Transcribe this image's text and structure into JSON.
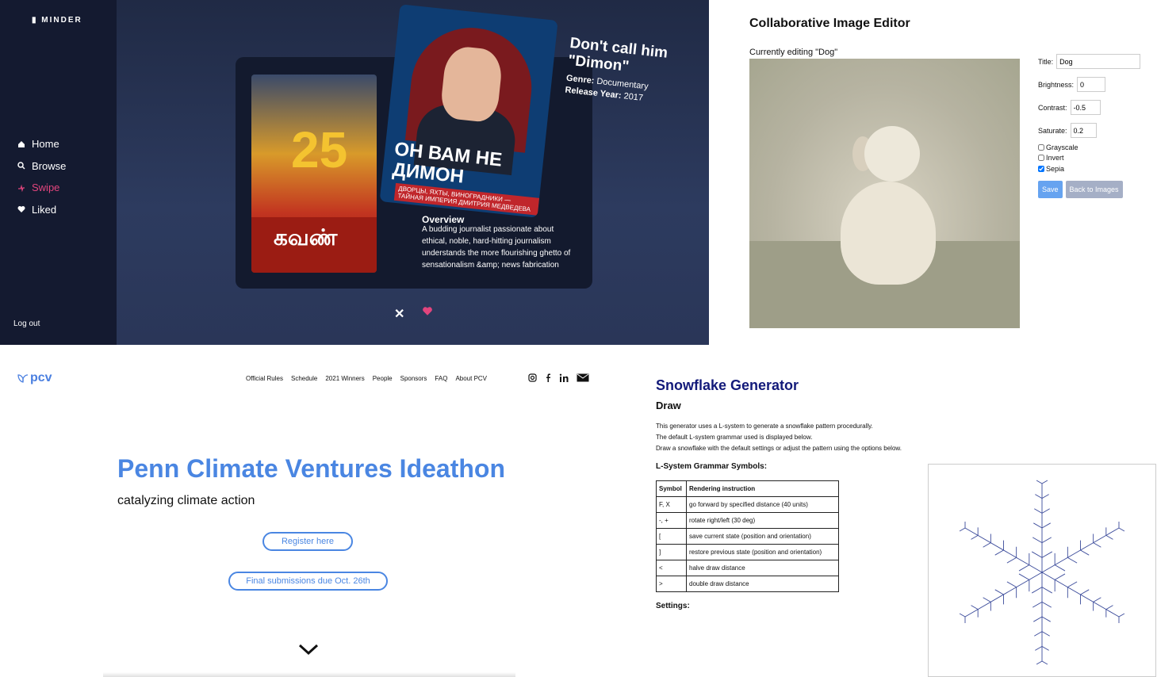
{
  "minder": {
    "brand": "MINDER",
    "nav": [
      {
        "label": "Home",
        "icon": "home-icon"
      },
      {
        "label": "Browse",
        "icon": "search-icon"
      },
      {
        "label": "Swipe",
        "icon": "swipe-icon",
        "active": true
      },
      {
        "label": "Liked",
        "icon": "heart-icon"
      }
    ],
    "logout": "Log out",
    "poster_back": {
      "number": "25",
      "title": "கவண்"
    },
    "poster_front": {
      "headline": "ОН ВАМ НЕ ДИМОН",
      "tagline": "ДВОРЦЫ, ЯХТЫ, ВИНОГРАДНИКИ — ТАЙНАЯ ИМПЕРИЯ ДМИТРИЯ МЕДВЕДЕВА"
    },
    "movie": {
      "title": "Don't call him \"Dimon\"",
      "genre_label": "Genre:",
      "genre": "Documentary",
      "year_label": "Release Year:",
      "year": "2017"
    },
    "overview_heading": "Overview",
    "overview_text": "A budding journalist passionate about ethical, noble, hard-hitting journalism understands the more flourishing ghetto of sensationalism &amp; news fabrication",
    "accent": "#e2457d"
  },
  "editor": {
    "title": "Collaborative Image Editor",
    "editing": "Currently editing \"Dog\"",
    "fields": {
      "title_label": "Title:",
      "title_value": "Dog",
      "brightness_label": "Brightness:",
      "brightness_value": "0",
      "contrast_label": "Contrast:",
      "contrast_value": "-0.5",
      "saturate_label": "Saturate:",
      "saturate_value": "0.2"
    },
    "checks": {
      "grayscale": "Grayscale",
      "invert": "Invert",
      "sepia": "Sepia"
    },
    "buttons": {
      "save": "Save",
      "back": "Back to Images"
    }
  },
  "pcv": {
    "logo": "pcv",
    "nav": [
      "Official Rules",
      "Schedule",
      "2021 Winners",
      "People",
      "Sponsors",
      "FAQ",
      "About PCV"
    ],
    "title": "Penn Climate Ventures Ideathon",
    "subtitle": "catalyzing climate action",
    "register": "Register here",
    "deadline": "Final submissions due Oct. 26th",
    "accent": "#4a86e2"
  },
  "snow": {
    "title": "Snowflake Generator",
    "section": "Draw",
    "desc": [
      "This generator uses a L-system to generate a snowflake pattern procedurally.",
      "The default L-system grammar used is displayed below.",
      "Draw a snowflake with the default settings or adjust the pattern using the options below."
    ],
    "grammar_heading": "L-System Grammar Symbols:",
    "table_headers": [
      "Symbol",
      "Rendering instruction"
    ],
    "rows": [
      [
        "F, X",
        "go forward by specified distance (40 units)"
      ],
      [
        "-, +",
        "rotate right/left (30 deg)"
      ],
      [
        "[",
        "save current state (position and orientation)"
      ],
      [
        "]",
        "restore previous state (position and orientation)"
      ],
      [
        "<",
        "halve draw distance"
      ],
      [
        ">",
        "double draw distance"
      ]
    ],
    "settings": "Settings:"
  }
}
